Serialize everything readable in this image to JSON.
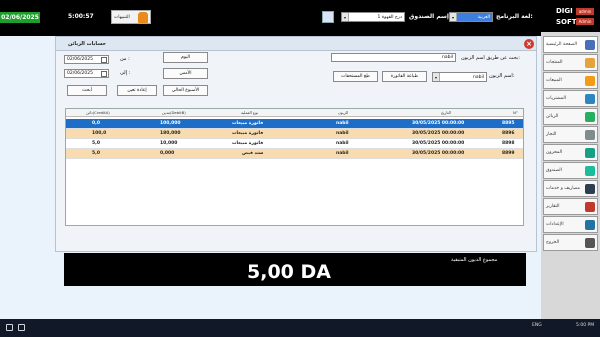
{
  "topbar": {
    "date": "02/06/2025",
    "time": "5:00:57",
    "notifications_label": "التنبيهات",
    "cashbox_label": "إسم الصندوق:",
    "cashbox_value": "درج القهوة 1",
    "program_lang_label": "لغة البرنامج:",
    "program_lang_value": "العربية",
    "logo_line1": "DIGI",
    "logo_line2": "SOFT",
    "user_badge1": "admin",
    "user_badge2": "Admin"
  },
  "sidebar": {
    "items": [
      {
        "label": "الصفحة الرئيسية",
        "icon": "home-icon",
        "color": "#4a6fb8"
      },
      {
        "label": "المنتجات",
        "icon": "products-icon",
        "color": "#e6a23c"
      },
      {
        "label": "المبيعات",
        "icon": "sales-icon",
        "color": "#f39c12"
      },
      {
        "label": "المشتريات",
        "icon": "purchases-icon",
        "color": "#2e86c1"
      },
      {
        "label": "الزبائن",
        "icon": "customers-icon",
        "color": "#27ae60"
      },
      {
        "label": "التجار",
        "icon": "merchants-icon",
        "color": "#7f8c8d"
      },
      {
        "label": "المخزون",
        "icon": "stock-icon",
        "color": "#16a085"
      },
      {
        "label": "الصندوق",
        "icon": "cashbox-icon",
        "color": "#1abc9c"
      },
      {
        "label": "مصاريف و خدمات",
        "icon": "expenses-icon",
        "color": "#2c3e50"
      },
      {
        "label": "التقارير",
        "icon": "reports-icon",
        "color": "#c0392b"
      },
      {
        "label": "الإعدادات",
        "icon": "settings-icon",
        "color": "#2471a3"
      },
      {
        "label": "الخروج",
        "icon": "exit-icon",
        "color": "#555555"
      }
    ]
  },
  "panel": {
    "title": "حسابات الزبائن",
    "search_label": "بحث عن طريق اسم الزبون:",
    "search_value": "nabil",
    "customer_label": "اسم الزبون:",
    "customer_value": "nabil",
    "print_invoice": "طباعة الفاتورة",
    "print_debts": "طع المستحقات",
    "from_label": "من :",
    "to_label": "إلى :",
    "from_date": "02/06/2025",
    "to_date": "02/06/2025",
    "today_btn": "اليوم",
    "yesterday_btn": "الأمس",
    "this_week_btn": "الأسبوع الحالي",
    "reset_btn": "إعادة تعين",
    "search_btn": "أبحث"
  },
  "table": {
    "headers": [
      "N°",
      "التاريخ",
      "الزبون",
      "نوع العملية",
      "مدين(DebitB)",
      "دائن(CreditA)"
    ],
    "rows": [
      {
        "n": "8895",
        "date": "30/05/2025 00:00:00",
        "customer": "nabil",
        "type": "فاتورة مبيعات",
        "debit": "100,000",
        "credit": "0,0"
      },
      {
        "n": "8896",
        "date": "30/05/2025 00:00:00",
        "customer": "nabil",
        "type": "فاتورة مبيعات",
        "debit": "180,000",
        "credit": "100,0"
      },
      {
        "n": "8898",
        "date": "30/05/2025 00:00:00",
        "customer": "nabil",
        "type": "فاتورة مبيعات",
        "debit": "10,000",
        "credit": "5,0"
      },
      {
        "n": "8899",
        "date": "30/05/2025 00:00:00",
        "customer": "nabil",
        "type": "سند قبض",
        "debit": "0,000",
        "credit": "5,0"
      }
    ]
  },
  "footer": {
    "title": "مجموع الديون المتبقية",
    "amount": "5,00 DA"
  },
  "taskbar": {
    "lang": "ENG",
    "time": "5:00 PM"
  },
  "colors": {
    "accent": "#1e6ec8",
    "date_badge": "#1f9e2c",
    "row_alt": "#f8dcb0",
    "close": "#d0392b"
  }
}
